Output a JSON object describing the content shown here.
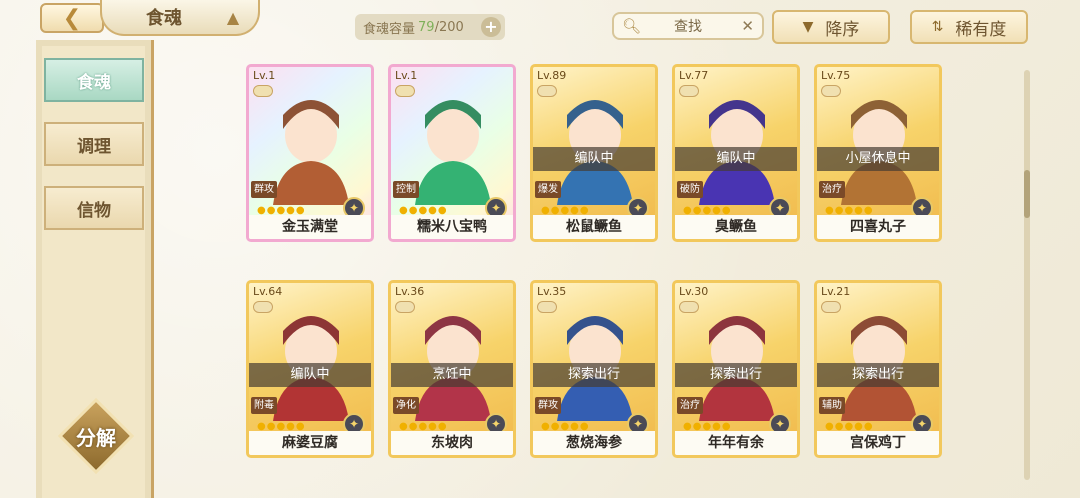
{
  "header": {
    "back_icon": "back-arrow-icon",
    "title": "食魂",
    "capacity_label": "食魂容量",
    "capacity_current": "79",
    "capacity_max": "/200",
    "search_label": "查找",
    "sort_order": "降序",
    "sort_by": "稀有度"
  },
  "sidebar": {
    "items": [
      {
        "label": "食魂",
        "active": true
      },
      {
        "label": "调理",
        "active": false
      },
      {
        "label": "信物",
        "active": false
      }
    ],
    "decompose_label": "分解"
  },
  "cards": [
    {
      "level": "Lv.1",
      "name": "金玉满堂",
      "status": "",
      "role": "群攻",
      "rainbow": true
    },
    {
      "level": "Lv.1",
      "name": "糯米八宝鸭",
      "status": "",
      "role": "控制",
      "rainbow": true
    },
    {
      "level": "Lv.89",
      "name": "松鼠鳜鱼",
      "status": "编队中",
      "role": "爆发",
      "rainbow": false
    },
    {
      "level": "Lv.77",
      "name": "臭鳜鱼",
      "status": "编队中",
      "role": "破防",
      "rainbow": false
    },
    {
      "level": "Lv.75",
      "name": "四喜丸子",
      "status": "小屋休息中",
      "role": "治疗",
      "rainbow": false
    },
    {
      "level": "Lv.64",
      "name": "麻婆豆腐",
      "status": "编队中",
      "role": "附毒",
      "rainbow": false
    },
    {
      "level": "Lv.36",
      "name": "东坡肉",
      "status": "烹饪中",
      "role": "净化",
      "rainbow": false
    },
    {
      "level": "Lv.35",
      "name": "葱烧海参",
      "status": "探索出行",
      "role": "群攻",
      "rainbow": false
    },
    {
      "level": "Lv.30",
      "name": "年年有余",
      "status": "探索出行",
      "role": "治疗",
      "rainbow": false
    },
    {
      "level": "Lv.21",
      "name": "宫保鸡丁",
      "status": "探索出行",
      "role": "辅助",
      "rainbow": false
    }
  ]
}
